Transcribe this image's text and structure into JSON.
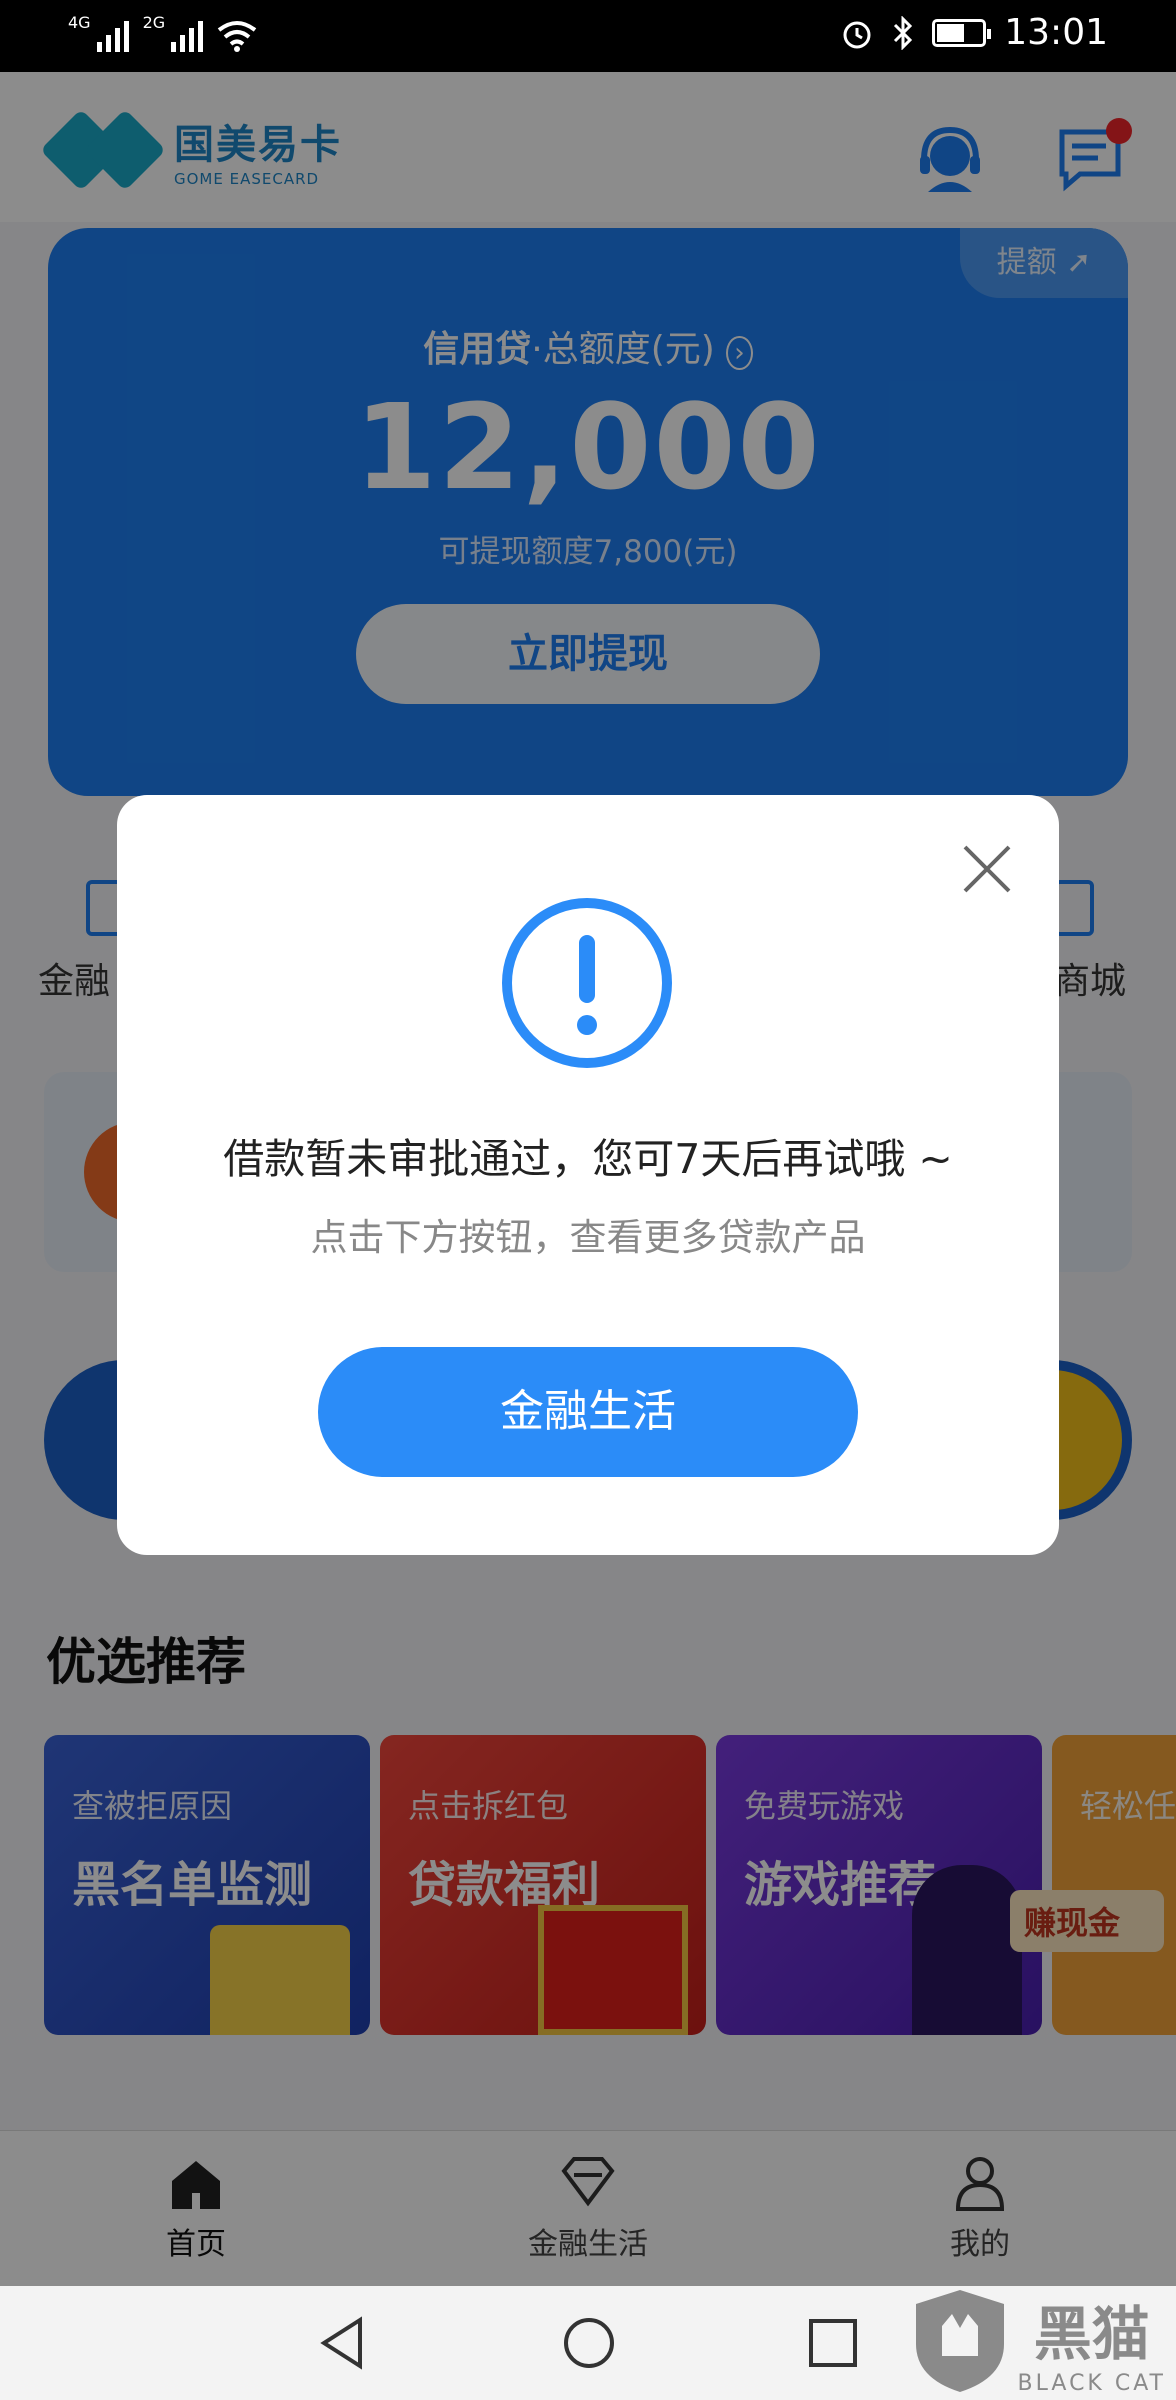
{
  "status_bar": {
    "net1": "4G",
    "net2": "2G",
    "time": "13:01"
  },
  "header": {
    "logo_cn": "国美易卡",
    "logo_en": "GOME EASECARD"
  },
  "credit": {
    "boost": "提额",
    "title_bold": "信用贷",
    "title_rest": "·总额度(元)",
    "amount": "12,000",
    "available": "可提现额度7,800(元)",
    "button": "立即提现"
  },
  "nav": {
    "left_label": "金融",
    "right_label": "商城"
  },
  "recommend": {
    "title": "优选推荐",
    "cards": [
      {
        "subtitle": "查被拒原因",
        "title": "黑名单监测",
        "color": "#2f56c7"
      },
      {
        "subtitle": "点击拆红包",
        "title": "贷款福利",
        "color": "#e8362f"
      },
      {
        "subtitle": "免费玩游戏",
        "title": "游戏推荐",
        "color": "#6b2fd6"
      },
      {
        "subtitle": "轻松任",
        "title": "赚现金",
        "color": "#f2a33a"
      }
    ]
  },
  "tabs": [
    {
      "label": "首页"
    },
    {
      "label": "金融生活"
    },
    {
      "label": "我的"
    }
  ],
  "dialog": {
    "message": "借款暂未审批通过，您可7天后再试哦 ~",
    "tip": "点击下方按钮，查看更多贷款产品",
    "button": "金融生活"
  },
  "watermark": {
    "cn": "黑猫",
    "en": "BLACK CAT"
  }
}
